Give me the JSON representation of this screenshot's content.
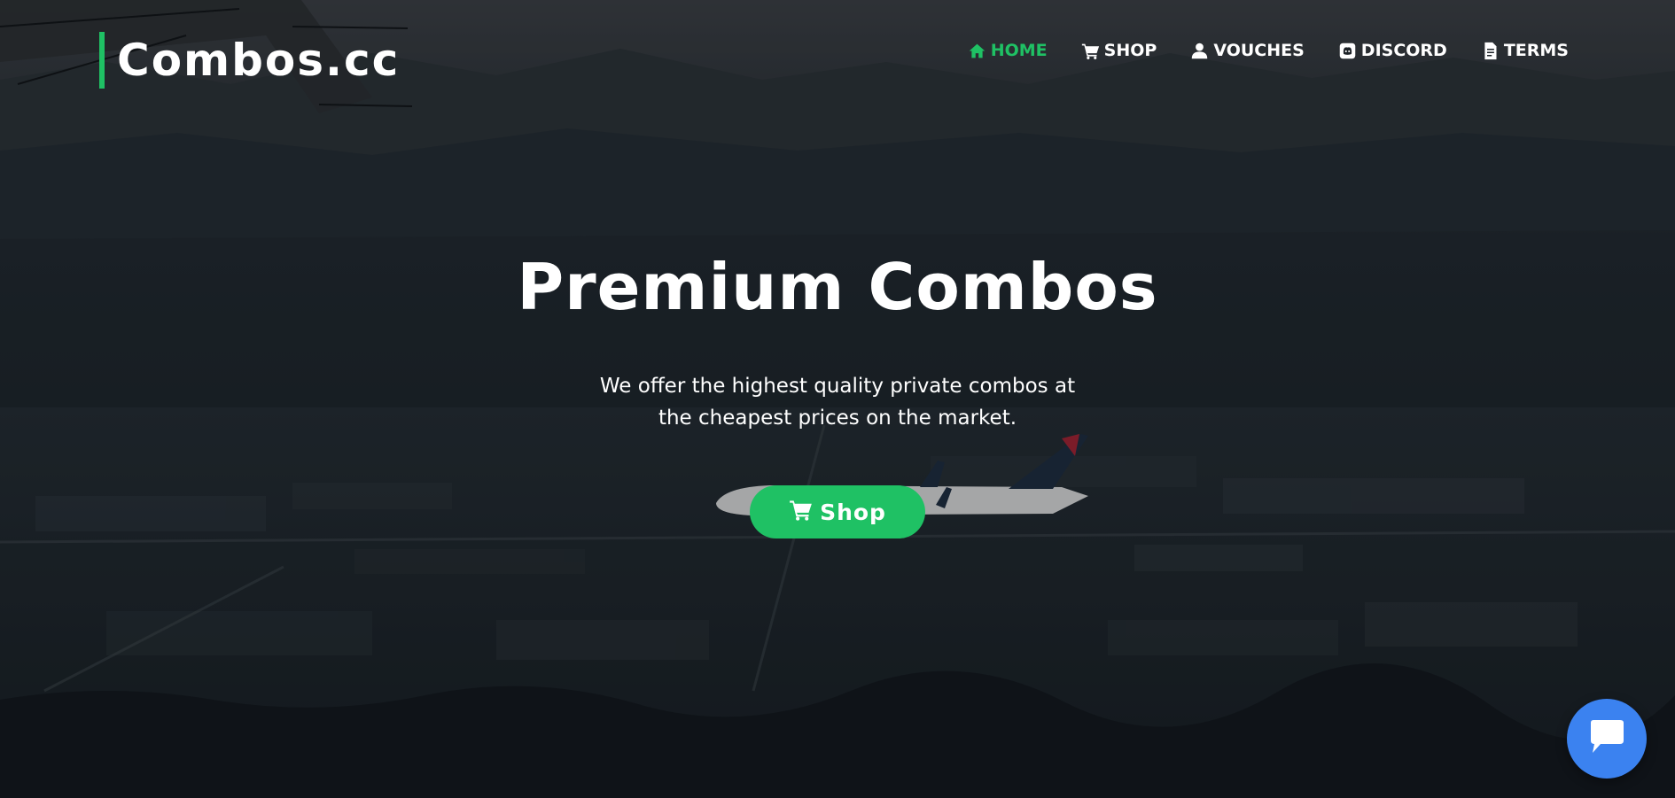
{
  "brand": {
    "name": "Combos.cc",
    "accent_color": "#1fc164"
  },
  "nav": {
    "items": [
      {
        "label": "HOME",
        "icon": "home-icon",
        "active": true
      },
      {
        "label": "SHOP",
        "icon": "cart-icon",
        "active": false
      },
      {
        "label": "VOUCHES",
        "icon": "user-icon",
        "active": false
      },
      {
        "label": "DISCORD",
        "icon": "discord-icon",
        "active": false
      },
      {
        "label": "TERMS",
        "icon": "document-icon",
        "active": false
      }
    ]
  },
  "hero": {
    "title": "Premium Combos",
    "subtitle": "We offer the highest quality private combos at the cheapest prices on the market.",
    "cta_label": "Shop",
    "cta_icon": "cart-icon"
  },
  "chat": {
    "icon": "chat-icon",
    "color": "#3b82f0"
  }
}
